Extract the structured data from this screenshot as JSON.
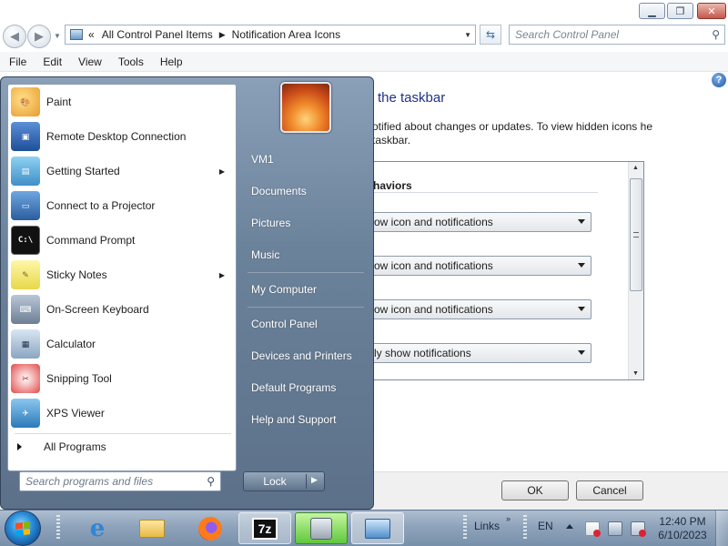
{
  "explorer": {
    "address": {
      "segment_1": "All Control Panel Items",
      "segment_2": "Notification Area Icons",
      "overflow": "«"
    },
    "search_placeholder": "Search Control Panel",
    "menu": [
      "File",
      "Edit",
      "View",
      "Tools",
      "Help"
    ],
    "heading": "the taskbar",
    "description": "otified about changes or updates. To view hidden icons he taskbar.",
    "column_header": "haviors",
    "behaviors": [
      "ow icon and notifications",
      "ow icon and notifications",
      "ow icon and notifications",
      "ly show notifications"
    ],
    "ok_label": "OK",
    "cancel_label": "Cancel"
  },
  "start_menu": {
    "programs": [
      {
        "label": "Paint",
        "icon": "paint-icon",
        "submenu": false
      },
      {
        "label": "Remote Desktop Connection",
        "icon": "remote-desktop-icon",
        "submenu": false
      },
      {
        "label": "Getting Started",
        "icon": "getting-started-icon",
        "submenu": true
      },
      {
        "label": "Connect to a Projector",
        "icon": "projector-icon",
        "submenu": false
      },
      {
        "label": "Command Prompt",
        "icon": "command-prompt-icon",
        "submenu": false
      },
      {
        "label": "Sticky Notes",
        "icon": "sticky-notes-icon",
        "submenu": true
      },
      {
        "label": "On-Screen Keyboard",
        "icon": "keyboard-icon",
        "submenu": false
      },
      {
        "label": "Calculator",
        "icon": "calculator-icon",
        "submenu": false
      },
      {
        "label": "Snipping Tool",
        "icon": "snipping-tool-icon",
        "submenu": false
      },
      {
        "label": "XPS Viewer",
        "icon": "xps-viewer-icon",
        "submenu": false
      }
    ],
    "all_programs": "All Programs",
    "search_placeholder": "Search programs and files",
    "right_items": [
      "VM1",
      "Documents",
      "Pictures",
      "Music",
      "My Computer",
      "Control Panel",
      "Devices and Printers",
      "Default Programs",
      "Help and Support"
    ],
    "lock_label": "Lock"
  },
  "taskbar": {
    "links": "Links",
    "chevron": "»",
    "lang": "EN",
    "seven_zip": "7z",
    "time": "12:40 PM",
    "date": "6/10/2023"
  }
}
